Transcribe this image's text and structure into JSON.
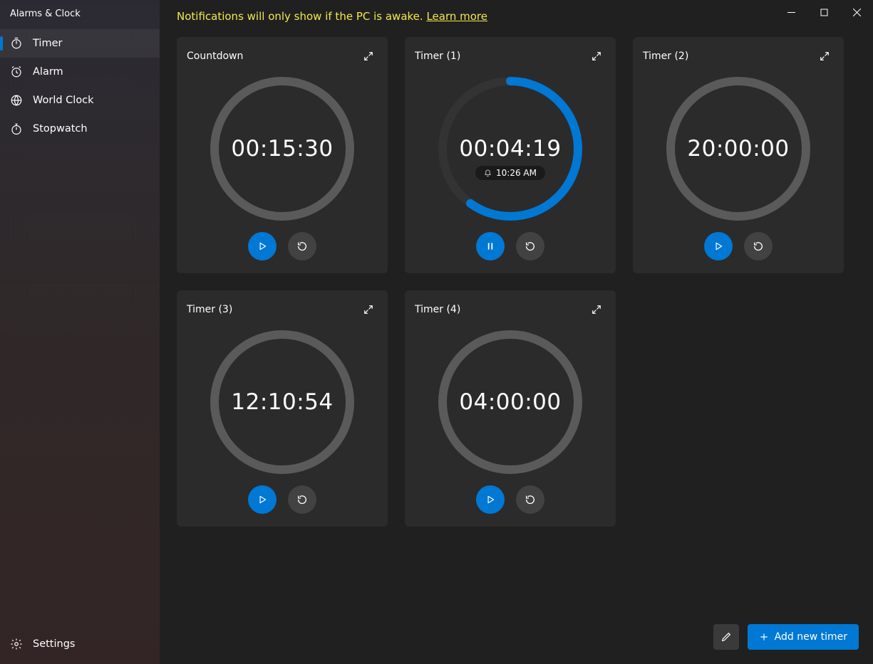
{
  "window": {
    "title": "Alarms & Clock"
  },
  "sidebar": {
    "items": [
      {
        "label": "Timer",
        "selected": true
      },
      {
        "label": "Alarm",
        "selected": false
      },
      {
        "label": "World Clock",
        "selected": false
      },
      {
        "label": "Stopwatch",
        "selected": false
      }
    ],
    "settings_label": "Settings"
  },
  "notice": {
    "text": "Notifications will only show if the PC is awake. ",
    "link_label": "Learn more"
  },
  "timers": [
    {
      "name": "Countdown",
      "display": "00:15:30",
      "progress": 0,
      "running": false,
      "bell": null
    },
    {
      "name": "Timer (1)",
      "display": "00:04:19",
      "progress": 0.6,
      "running": true,
      "bell": "10:26 AM"
    },
    {
      "name": "Timer (2)",
      "display": "20:00:00",
      "progress": 0,
      "running": false,
      "bell": null
    },
    {
      "name": "Timer (3)",
      "display": "12:10:54",
      "progress": 0,
      "running": false,
      "bell": null
    },
    {
      "name": "Timer (4)",
      "display": "04:00:00",
      "progress": 0,
      "running": false,
      "bell": null
    }
  ],
  "footer": {
    "add_label": "Add new timer"
  },
  "colors": {
    "accent": "#0078D4",
    "ring_idle": "#5a5a5a"
  }
}
